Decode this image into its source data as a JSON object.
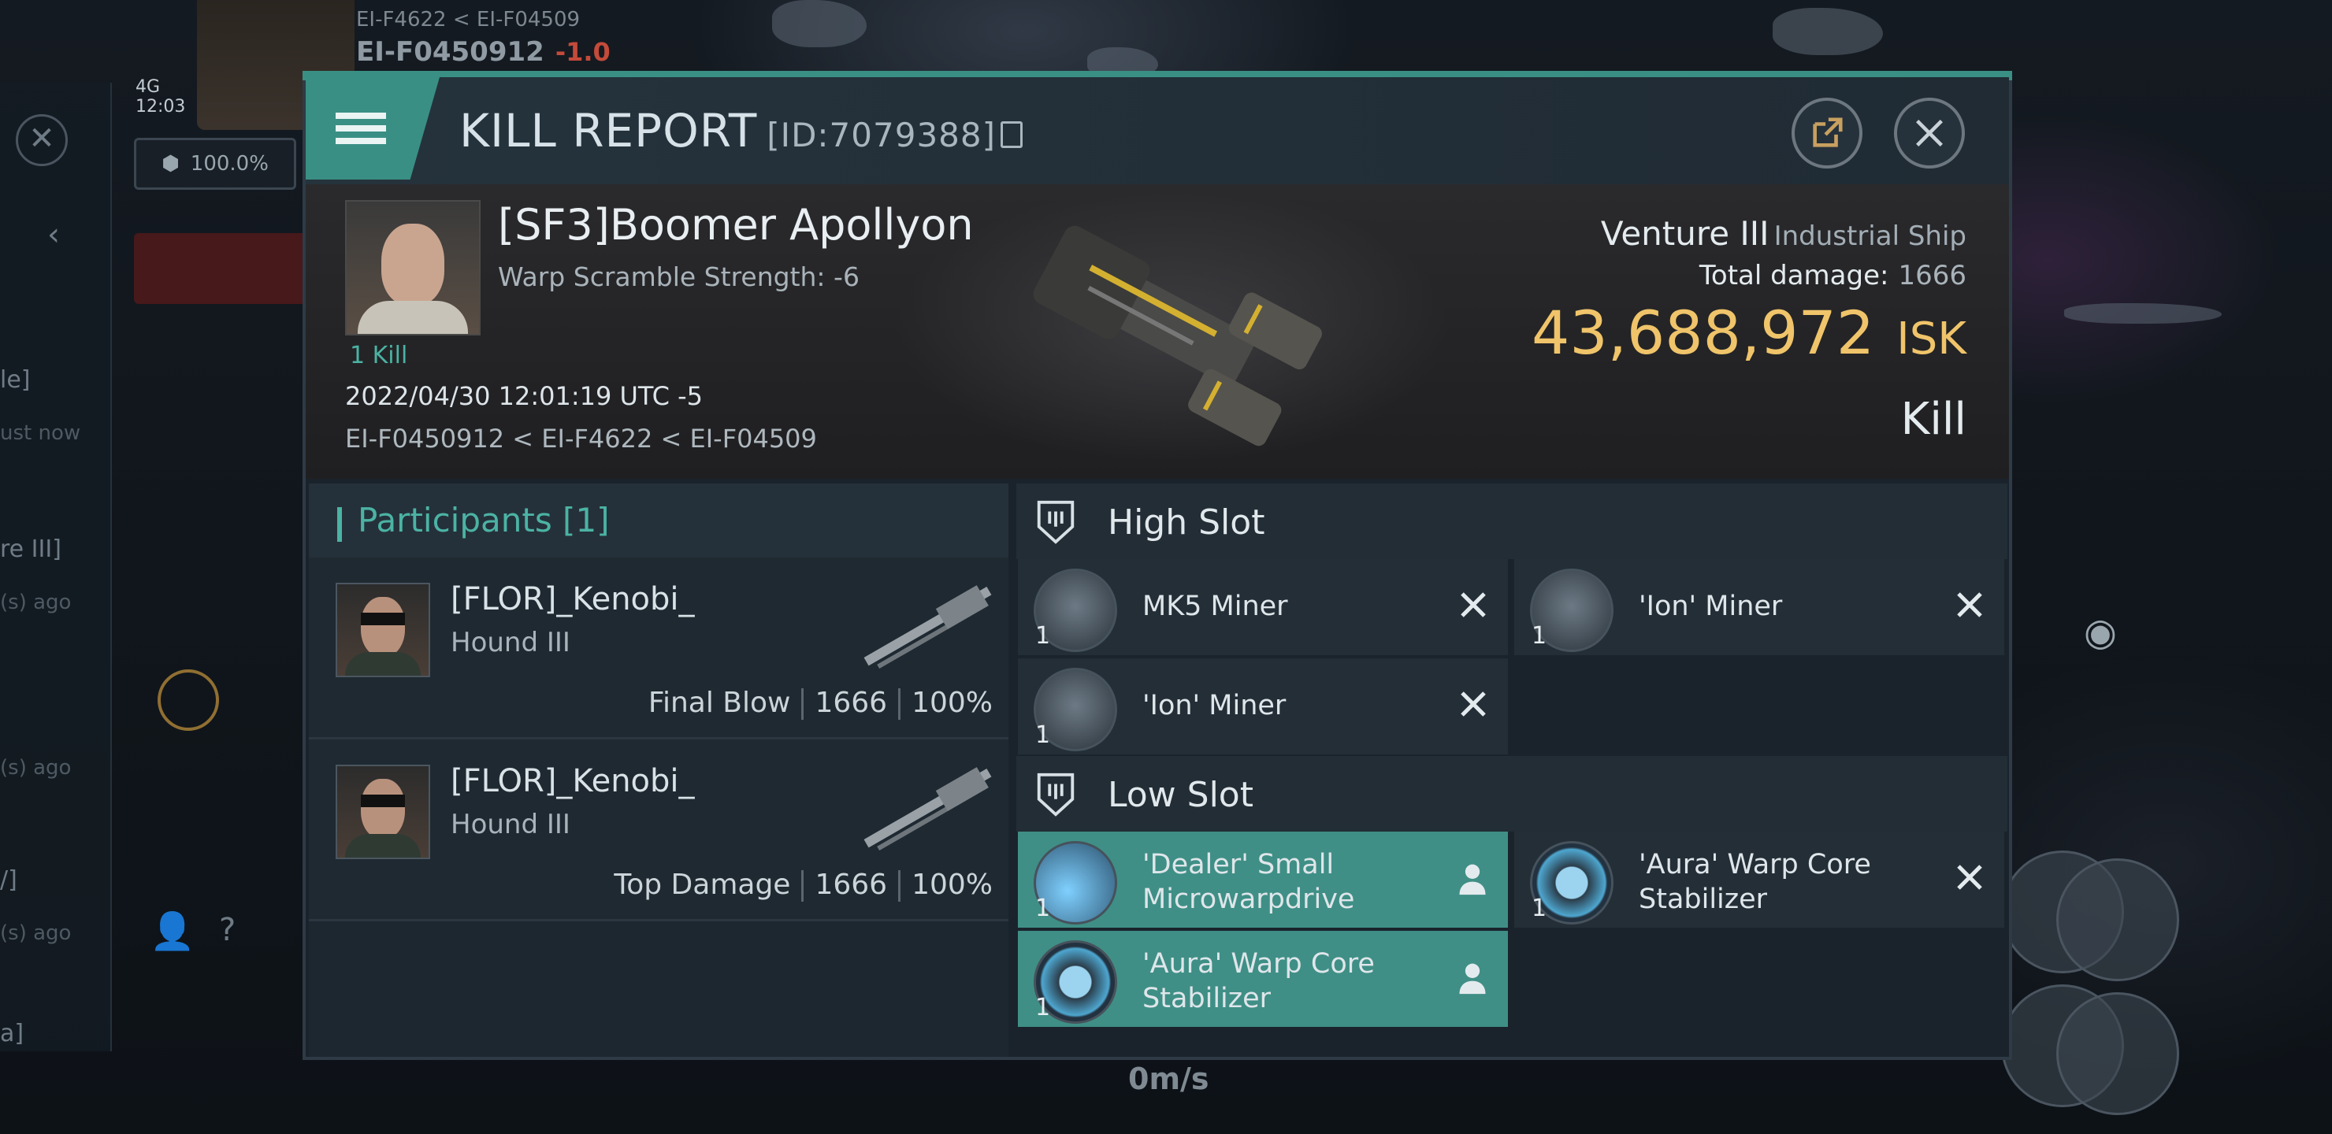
{
  "background": {
    "hud_route": "EI-F4622 < EI-F04509",
    "hud_system": "EI-F0450912",
    "hud_security": "-1.0",
    "hud_network": "4G",
    "hud_time": "12:03",
    "hud_cargo": "100.0%",
    "hud_speed": "0m/s",
    "hud_left_labels": [
      "le]",
      "ust now",
      "re III]",
      "(s) ago",
      "(s) ago",
      "/]",
      "(s) ago",
      "a]"
    ]
  },
  "kill_report": {
    "title": "KILL REPORT",
    "id_label": "[ID:7079388]",
    "victim": {
      "name": "[SF3]Boomer Apollyon",
      "subtitle": "Warp Scramble Strength: -6",
      "kills": "1 Kill",
      "time": "2022/04/30 12:01:19 UTC -5",
      "route": "EI-F0450912 < EI-F4622 < EI-F04509"
    },
    "ship": {
      "name": "Venture III",
      "type": "Industrial Ship",
      "total_damage_label": "Total damage:",
      "total_damage": "1666",
      "isk_value": "43,688,972",
      "isk_unit": "ISK",
      "result": "Kill"
    },
    "participants": {
      "header": "Participants [1]",
      "rows": [
        {
          "name": "[FLOR]_Kenobi_",
          "ship": "Hound III",
          "role": "Final Blow",
          "damage": "1666",
          "percent": "100%"
        },
        {
          "name": "[FLOR]_Kenobi_",
          "ship": "Hound III",
          "role": "Top Damage",
          "damage": "1666",
          "percent": "100%"
        }
      ]
    },
    "high_slot": {
      "label": "High Slot",
      "modules": [
        {
          "name": "MK5 Miner",
          "qty": "1"
        },
        {
          "name": "'Ion' Miner",
          "qty": "1"
        },
        {
          "name": "'Ion' Miner",
          "qty": "1"
        }
      ]
    },
    "low_slot": {
      "label": "Low Slot",
      "modules": [
        {
          "name": "'Dealer' Small Microwarpdrive",
          "qty": "1"
        },
        {
          "name": "'Aura' Warp Core Stabilizer",
          "qty": "1"
        },
        {
          "name": "'Aura' Warp Core Stabilizer",
          "qty": "1"
        }
      ]
    }
  },
  "colors": {
    "accent": "#3a8f84",
    "isk": "#f0c46a",
    "teal_text": "#4bb3a4"
  }
}
